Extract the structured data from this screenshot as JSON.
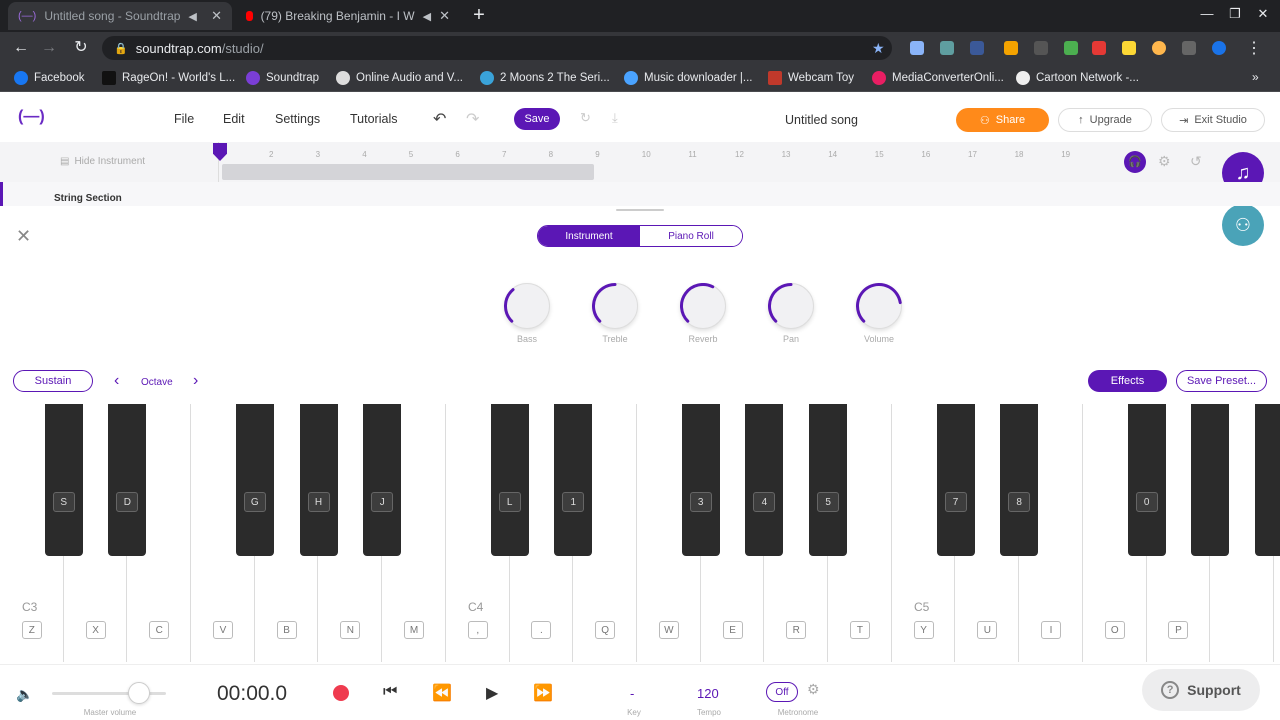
{
  "browser": {
    "tabs": [
      {
        "title": "Untitled song - Soundtrap",
        "active": true
      },
      {
        "title": "(79) Breaking Benjamin - I W",
        "active": false
      }
    ],
    "url_host": "soundtrap.com",
    "url_path": "/studio/",
    "bookmarks": [
      {
        "label": "Facebook",
        "color": "#1877f2"
      },
      {
        "label": "RageOn! - World's L...",
        "color": "#111111"
      },
      {
        "label": "Soundtrap",
        "color": "#7a3ed6"
      },
      {
        "label": "Online Audio and V...",
        "color": "#dddddd"
      },
      {
        "label": "2 Moons 2 The Seri...",
        "color": "#3aa3d9"
      },
      {
        "label": "Music downloader |...",
        "color": "#4aa3ff"
      },
      {
        "label": "Webcam Toy",
        "color": "#c0392b"
      },
      {
        "label": "MediaConverterOnli...",
        "color": "#e91e63"
      },
      {
        "label": "Cartoon Network -...",
        "color": "#eeeeee"
      }
    ]
  },
  "app": {
    "logo": "(—)",
    "menu": [
      "File",
      "Edit",
      "Settings",
      "Tutorials"
    ],
    "save_label": "Save",
    "song_title": "Untitled song",
    "share_label": "Share",
    "upgrade_label": "Upgrade",
    "exit_label": "Exit Studio",
    "accent": "#5b17b5",
    "share_color": "#ff8a1a"
  },
  "timeline": {
    "hide_instrument_label": "Hide Instrument",
    "ticks": [
      "2",
      "3",
      "4",
      "5",
      "6",
      "7",
      "8",
      "9",
      "10",
      "11",
      "12",
      "13",
      "14",
      "15",
      "16",
      "17",
      "18",
      "19"
    ],
    "track_name": "String Section"
  },
  "panel": {
    "tabs": {
      "instrument": "Instrument",
      "piano_roll": "Piano Roll"
    },
    "knobs": [
      {
        "label": "Bass",
        "level": 0.35
      },
      {
        "label": "Treble",
        "level": 0.5
      },
      {
        "label": "Reverb",
        "level": 0.6
      },
      {
        "label": "Pan",
        "level": 0.5
      },
      {
        "label": "Volume",
        "level": 0.8
      }
    ],
    "sustain_label": "Sustain",
    "octave_label": "Octave",
    "effects_label": "Effects",
    "save_preset_label": "Save Preset..."
  },
  "piano": {
    "white_keys": [
      "Z",
      "X",
      "C",
      "V",
      "B",
      "N",
      "M",
      ",",
      ".",
      "Q",
      "W",
      "E",
      "R",
      "T",
      "Y",
      "U",
      "I",
      "O",
      "P",
      ""
    ],
    "octave_labels": {
      "c3": "C3",
      "c4": "C4",
      "c5": "C5"
    },
    "black_keys": [
      "S",
      "D",
      "G",
      "H",
      "J",
      "L",
      "1",
      "3",
      "4",
      "5",
      "7",
      "8",
      "0",
      "",
      ""
    ]
  },
  "transport": {
    "master_volume_label": "Master volume",
    "time": "00:00.0",
    "key_value": "-",
    "key_label": "Key",
    "tempo_value": "120",
    "tempo_label": "Tempo",
    "metronome_value": "Off",
    "metronome_label": "Metronome",
    "support_label": "Support"
  }
}
